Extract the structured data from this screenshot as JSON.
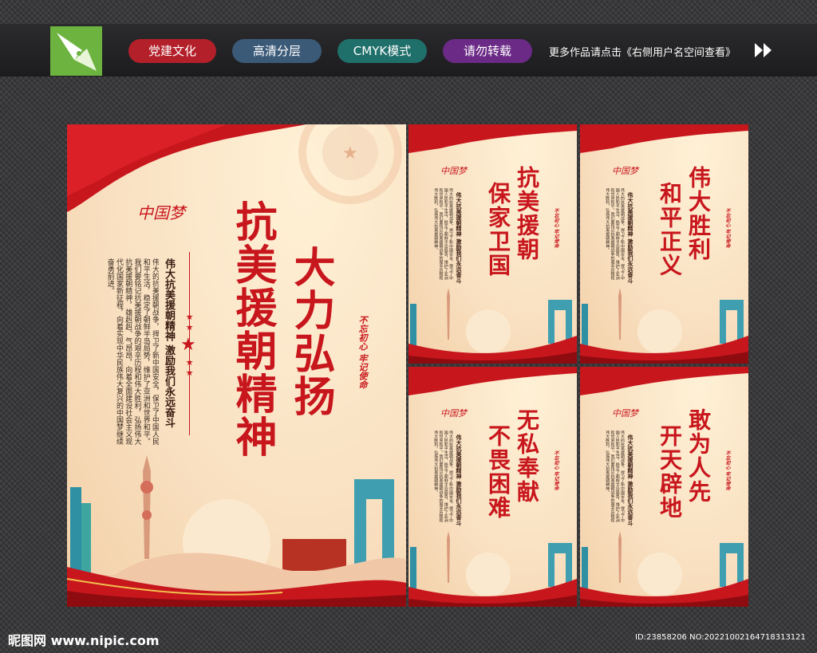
{
  "topbar": {
    "tags": [
      {
        "label": "党建文化",
        "color": "#b3202a"
      },
      {
        "label": "高清分层",
        "color": "#3b5a78"
      },
      {
        "label": "CMYK模式",
        "color": "#1f6f6a"
      },
      {
        "label": "请勿转载",
        "color": "#6a2a86"
      }
    ],
    "promo": "更多作品请点击《右侧用户名空间查看》"
  },
  "main_poster": {
    "brand": "中国梦",
    "title_left": "抗美援朝精神",
    "title_right": "大力弘扬",
    "subtitle": "伟大抗美援朝精神 激励我们永远奋斗",
    "body": "伟大的抗美援朝战争，捍卫了新中国安全，保卫了中国人民和平生活，稳定了朝鲜半岛局势，维护了亚洲和世界和平。我们要铭记抗美援朝战争的艰辛历程和伟大胜利，弘扬伟大抗美援朝精神，雄赳赳、气昂昂，向着全面建设社会主义现代化国家新征程，向着实现中华民族伟大复兴的中国梦继续奋勇前进。",
    "stamp": "不忘初心 牢记使命"
  },
  "small_posters": [
    {
      "title_right": "抗美援朝",
      "title_left": "保家卫国"
    },
    {
      "title_right": "伟大胜利",
      "title_left": "和平正义"
    },
    {
      "title_right": "无私奉献",
      "title_left": "不畏困难"
    },
    {
      "title_right": "敢为人先",
      "title_left": "开天辟地"
    }
  ],
  "small_common": {
    "brand": "中国梦",
    "subtitle": "伟大抗美援朝精神 激励我们永远奋斗",
    "body": "伟大的抗美援朝战争，捍卫了新中国安全，保卫了中国人民和平生活，稳定了朝鲜半岛局势，维护了亚洲和世界和平。我们要铭记抗美援朝战争的艰辛历程和伟大胜利，弘扬伟大抗美援朝精神。",
    "stamp": "不忘初心 牢记使命"
  },
  "footer": {
    "watermark": "昵图网 www.nipic.com",
    "image_id": "ID:23858206 NO:20221002164718313121"
  }
}
